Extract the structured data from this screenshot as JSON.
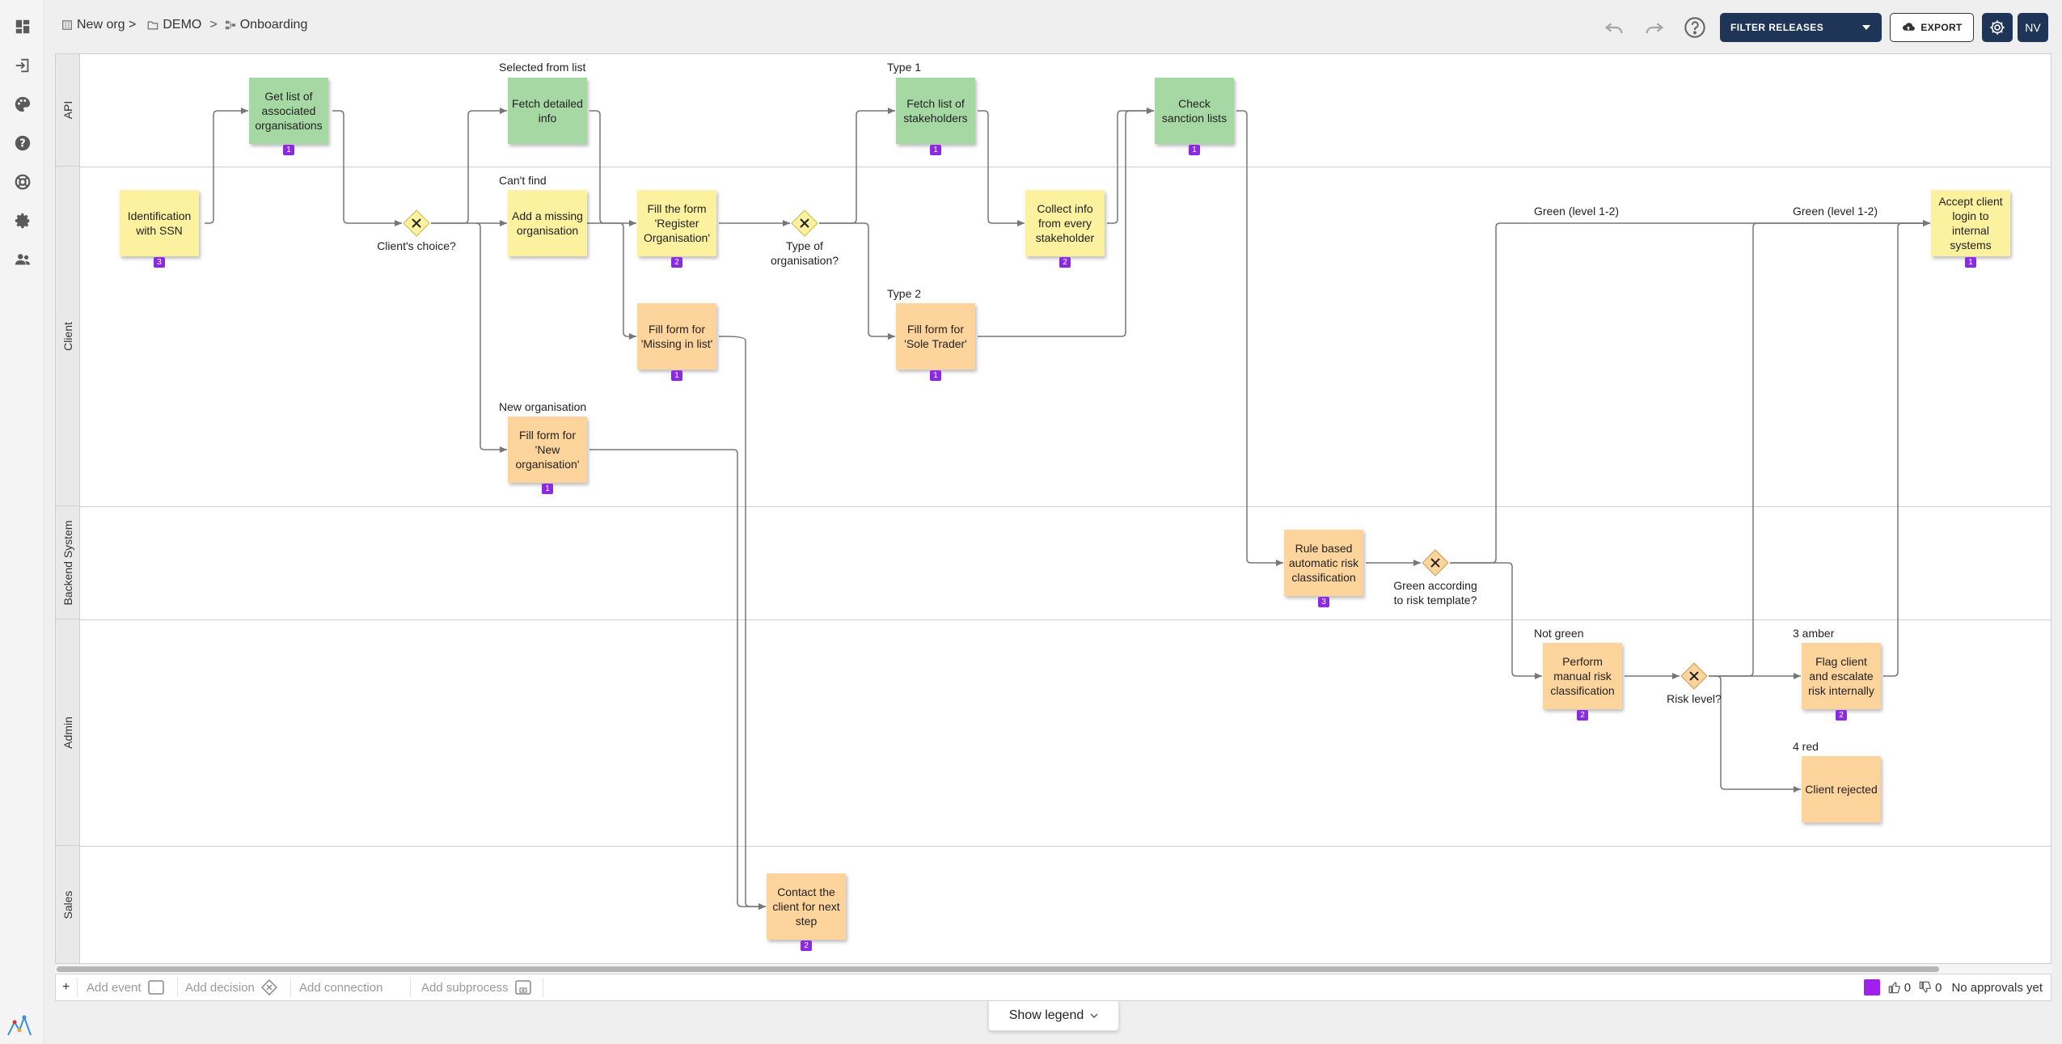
{
  "breadcrumb": {
    "org": "New org >",
    "folder": "DEMO",
    "sep": ">",
    "process": "Onboarding"
  },
  "toolbar": {
    "filter_label": "FILTER RELEASES",
    "export_label": "EXPORT",
    "avatar_initials": "NV"
  },
  "lanes": [
    "API",
    "Client",
    "Backend System",
    "Admin",
    "Sales"
  ],
  "nodes": {
    "n1": {
      "label": "Identification with SSN",
      "count": "3"
    },
    "n2": {
      "label": "Get list of associated organisations",
      "count": "1"
    },
    "n3": {
      "label": "Fetch detailed info"
    },
    "n4": {
      "label": "Add a missing organisation"
    },
    "n5": {
      "label": "Fill form for 'New organisation'",
      "count": "1"
    },
    "n6": {
      "label": "Fill the form 'Register Organisation'",
      "count": "2"
    },
    "n7": {
      "label": "Fill form for 'Missing in list'",
      "count": "1"
    },
    "n8": {
      "label": "Contact the client for next step",
      "count": "2"
    },
    "n9": {
      "label": "Fetch list of stakeholders",
      "count": "1"
    },
    "n10": {
      "label": "Fill form for 'Sole Trader'",
      "count": "1"
    },
    "n11": {
      "label": "Collect info from every stakeholder",
      "count": "2"
    },
    "n12": {
      "label": "Check sanction lists",
      "count": "1"
    },
    "n13": {
      "label": "Rule based automatic risk classification",
      "count": "3"
    },
    "n14": {
      "label": "Perform manual risk classification",
      "count": "2"
    },
    "n15": {
      "label": "Flag client and escalate risk internally",
      "count": "2"
    },
    "n16": {
      "label": "Client rejected"
    },
    "n17": {
      "label": "Accept client login to internal systems",
      "count": "1"
    }
  },
  "gateways": {
    "g1": "Client's choice?",
    "g2": "Type of organisation?",
    "g3": "Green according to risk template?",
    "g4": "Risk level?"
  },
  "edge_labels": {
    "selected": "Selected from list",
    "cant_find": "Can't find",
    "new_org": "New organisation",
    "type1": "Type 1",
    "type2": "Type 2",
    "green1": "Green (level 1-2)",
    "green2": "Green (level 1-2)",
    "not_green": "Not green",
    "amber": "3 amber",
    "red": "4 red"
  },
  "bottombar": {
    "add": "+",
    "add_event": "Add event",
    "add_decision": "Add decision",
    "add_connection": "Add connection",
    "add_subprocess": "Add subprocess",
    "likes": "0",
    "dislikes": "0",
    "approvals": "No approvals yet"
  },
  "legend_label": "Show legend",
  "colors": {
    "api_green": "#a6d8a4",
    "client_yellow": "#fbf19f",
    "task_orange": "#fdd49b",
    "navy": "#1e3557",
    "badge_purple": "#8a2be2"
  }
}
